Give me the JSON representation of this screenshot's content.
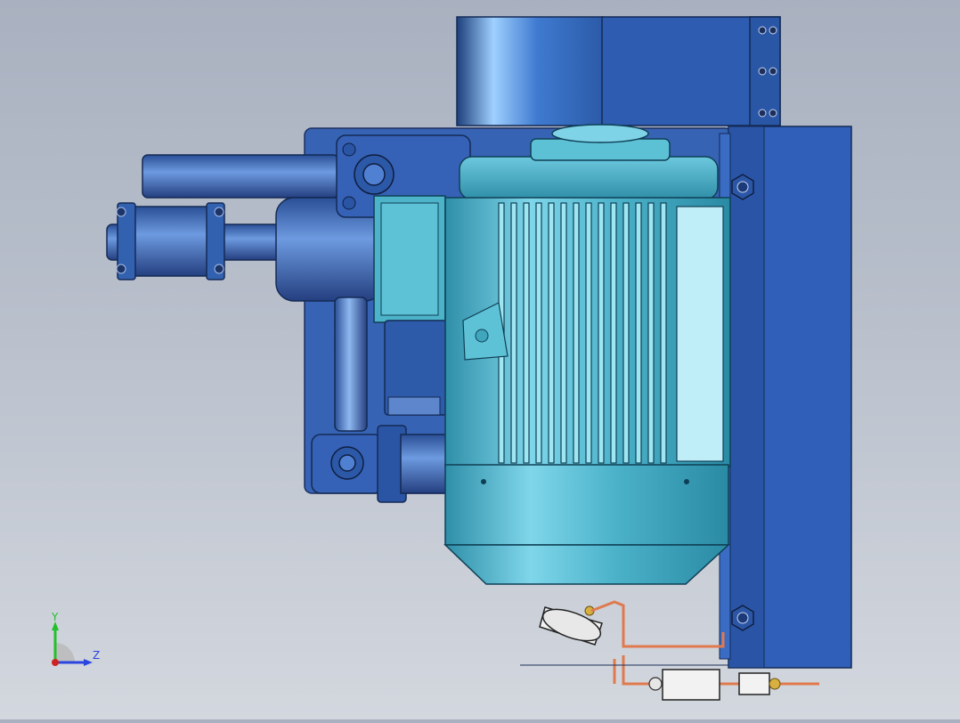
{
  "viewport": {
    "background_top": "#a9b1c0",
    "background_bottom": "#d3d7de"
  },
  "model": {
    "colors": {
      "motor_body": "#4bb2c9",
      "motor_light": "#8fe0f0",
      "housing_blue": "#2f5fb0",
      "pump_blue": "#3b6bc0",
      "pipe_copper": "#e07a4e",
      "gauge_white": "#f2f2f2"
    }
  },
  "triad": {
    "y_label": "Y",
    "z_label": "Z",
    "y_color": "#22c02a",
    "z_color": "#2a44e0",
    "x_color": "#d02020"
  }
}
